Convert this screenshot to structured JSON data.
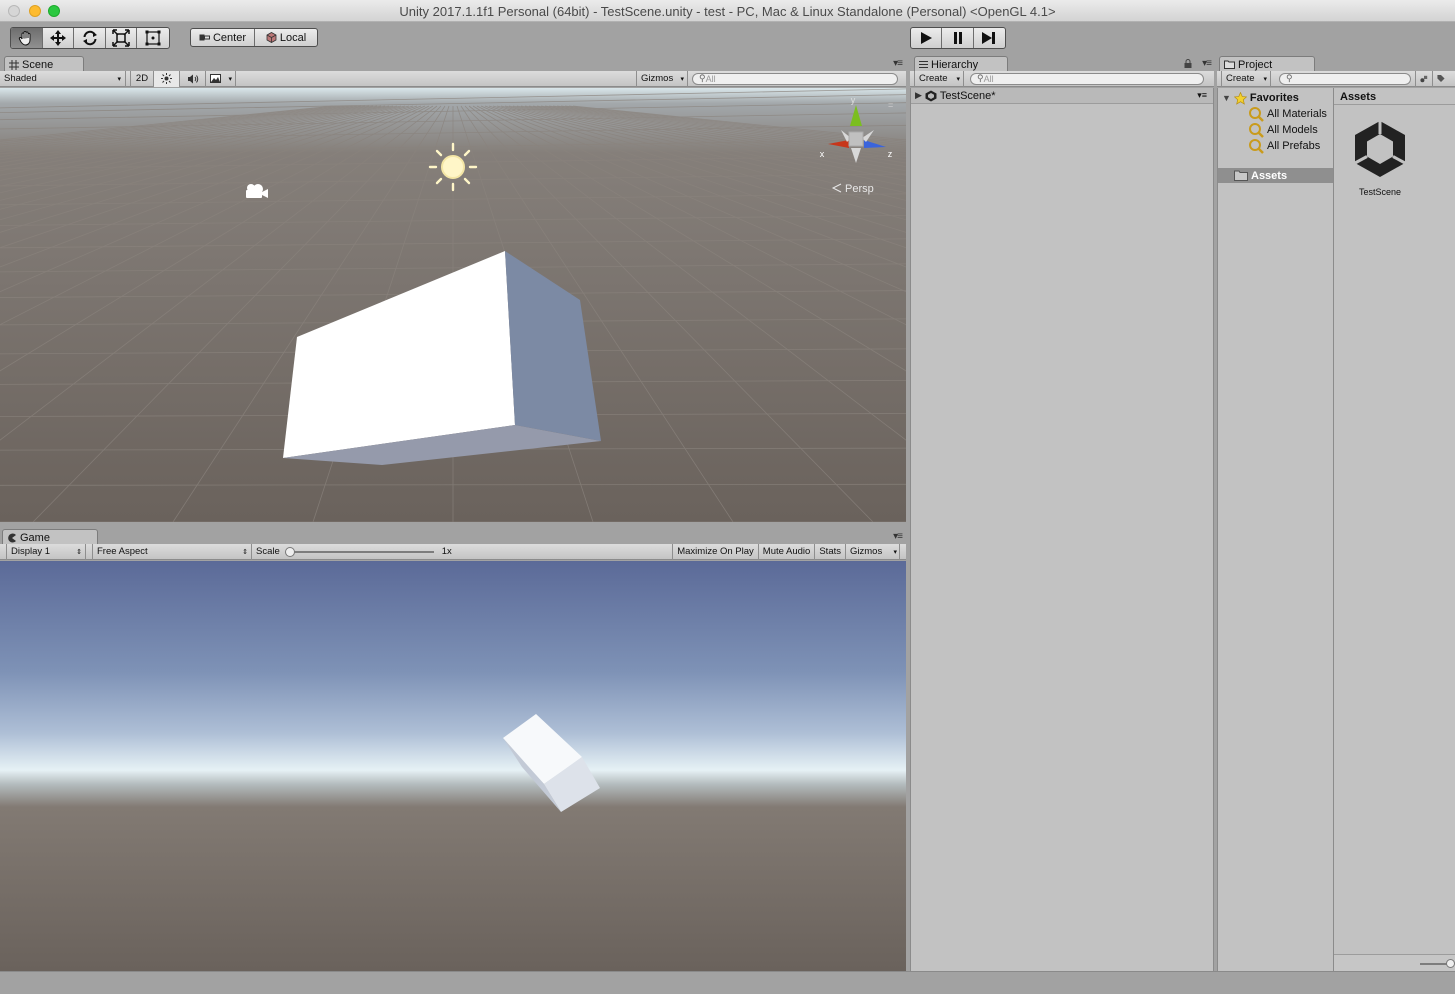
{
  "window": {
    "title": "Unity 2017.1.1f1 Personal (64bit) - TestScene.unity - test - PC, Mac & Linux Standalone (Personal) <OpenGL 4.1>"
  },
  "toolbar": {
    "tools": [
      "hand-tool-icon",
      "move-tool-icon",
      "rotate-tool-icon",
      "scale-tool-icon",
      "rect-tool-icon"
    ],
    "pivot_label": "Center",
    "space_label": "Local"
  },
  "scene": {
    "tab_label": "Scene",
    "shading_mode": "Shaded",
    "mode_2d": "2D",
    "gizmos_label": "Gizmos",
    "search_placeholder": "All",
    "gizmo_axes": {
      "y": "y",
      "x": "x",
      "z": "z"
    },
    "projection_label": "Persp"
  },
  "game": {
    "tab_label": "Game",
    "display": "Display 1",
    "aspect": "Free Aspect",
    "scale_label": "Scale",
    "scale_value": "1x",
    "maximize_label": "Maximize On Play",
    "mute_label": "Mute Audio",
    "stats_label": "Stats",
    "gizmos_label": "Gizmos"
  },
  "hierarchy": {
    "tab_label": "Hierarchy",
    "create_label": "Create",
    "search_placeholder": "All",
    "scene_name": "TestScene*"
  },
  "project": {
    "tab_label": "Project",
    "create_label": "Create",
    "favorites_label": "Favorites",
    "favorites": [
      "All Materials",
      "All Models",
      "All Prefabs"
    ],
    "assets_folder": "Assets",
    "assets_header": "Assets",
    "asset_name": "TestScene"
  },
  "colors": {
    "editor_bg": "#c2c2c2",
    "toolbar_bg": "#a2a2a2",
    "scene_ground": "#6f6761",
    "sky_top": "#5d6c99",
    "selection": "#8f8f8f"
  }
}
